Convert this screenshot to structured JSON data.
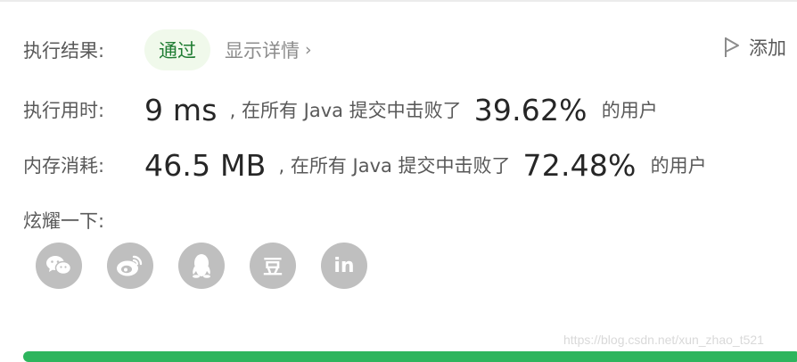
{
  "result": {
    "label": "执行结果:",
    "status": "通过",
    "details_link": "显示详情",
    "add_note": "添加"
  },
  "runtime": {
    "label": "执行用时:",
    "value": "9 ms",
    "comparison_text": ", 在所有 Java 提交中击败了",
    "percent": "39.62%",
    "suffix": "的用户"
  },
  "memory": {
    "label": "内存消耗:",
    "value": "46.5 MB",
    "comparison_text": ", 在所有 Java 提交中击败了",
    "percent": "72.48%",
    "suffix": "的用户"
  },
  "share": {
    "label": "炫耀一下:",
    "icons": [
      "wechat-icon",
      "weibo-icon",
      "qq-icon",
      "douban-icon",
      "linkedin-icon"
    ],
    "douban_glyph": "豆",
    "linkedin_glyph": "in"
  },
  "watermark": "https://blog.csdn.net/xun_zhao_t521",
  "colors": {
    "accepted_green": "#1e7c32",
    "pill_bg": "#f0f9eb",
    "icon_gray": "#bfbfbf",
    "bar_green": "#2db55d"
  }
}
